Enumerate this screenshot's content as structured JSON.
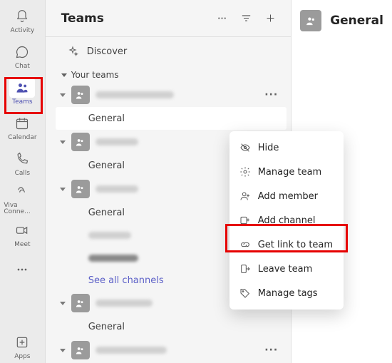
{
  "rail": {
    "items": [
      {
        "id": "activity",
        "label": "Activity"
      },
      {
        "id": "chat",
        "label": "Chat"
      },
      {
        "id": "teams",
        "label": "Teams"
      },
      {
        "id": "calendar",
        "label": "Calendar"
      },
      {
        "id": "calls",
        "label": "Calls"
      },
      {
        "id": "viva",
        "label": "Viva Conne..."
      },
      {
        "id": "meet",
        "label": "Meet"
      },
      {
        "id": "apps",
        "label": "Apps"
      }
    ]
  },
  "panel": {
    "title": "Teams",
    "discover_label": "Discover",
    "section_label": "Your teams",
    "see_all_label": "See all channels",
    "teams": [
      {
        "channels": [
          {
            "name": "General",
            "selected": true
          }
        ]
      },
      {
        "channels": [
          {
            "name": "General"
          }
        ]
      },
      {
        "channels": [
          {
            "name": "General"
          }
        ]
      },
      {
        "channels": [
          {
            "name": "General"
          }
        ]
      }
    ]
  },
  "context_menu": {
    "items": [
      {
        "id": "hide",
        "label": "Hide"
      },
      {
        "id": "manage",
        "label": "Manage team"
      },
      {
        "id": "addmember",
        "label": "Add member"
      },
      {
        "id": "addchannel",
        "label": "Add channel"
      },
      {
        "id": "getlink",
        "label": "Get link to team"
      },
      {
        "id": "leave",
        "label": "Leave team"
      },
      {
        "id": "tags",
        "label": "Manage tags"
      }
    ]
  },
  "content": {
    "title": "General"
  }
}
